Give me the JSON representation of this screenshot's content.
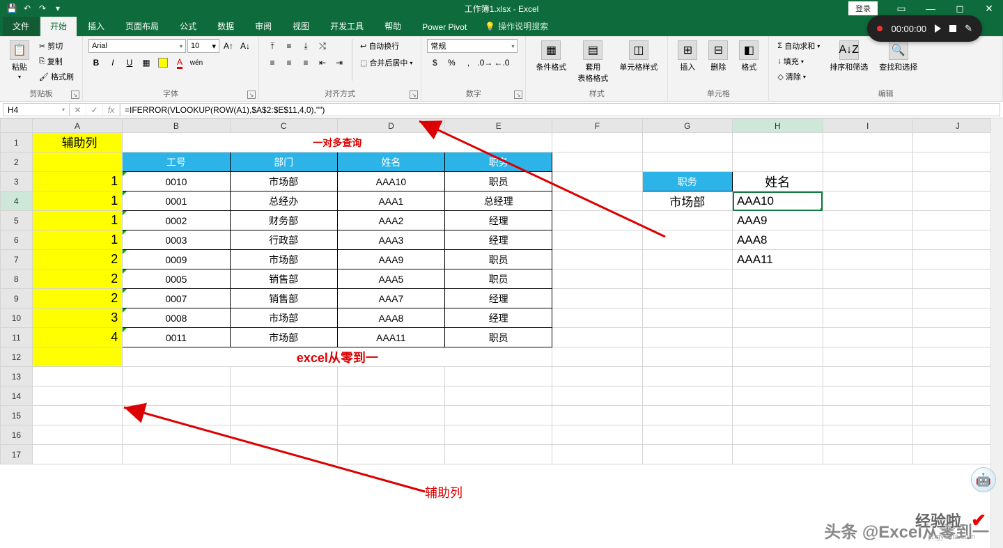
{
  "titlebar": {
    "title": "工作簿1.xlsx - Excel",
    "login": "登录"
  },
  "recorder": {
    "time": "00:00:00"
  },
  "tabs": {
    "file": "文件",
    "home": "开始",
    "insert": "插入",
    "page_layout": "页面布局",
    "formulas": "公式",
    "data": "数据",
    "review": "审阅",
    "view": "视图",
    "dev": "开发工具",
    "help": "帮助",
    "powerpivot": "Power Pivot",
    "tell_me": "操作说明搜索"
  },
  "ribbon": {
    "clipboard": {
      "paste": "粘贴",
      "cut": "剪切",
      "copy": "复制",
      "painter": "格式刷",
      "label": "剪贴板"
    },
    "font": {
      "name": "Arial",
      "size": "10",
      "label": "字体"
    },
    "align": {
      "wrap": "自动换行",
      "merge": "合并后居中",
      "label": "对齐方式"
    },
    "number": {
      "format": "常规",
      "label": "数字"
    },
    "styles": {
      "cond": "条件格式",
      "tbl": "套用\n表格格式",
      "cell": "单元格样式",
      "label": "样式"
    },
    "cells": {
      "insert": "插入",
      "delete": "删除",
      "format": "格式",
      "label": "单元格"
    },
    "editing": {
      "sum": "自动求和",
      "fill": "填充",
      "clear": "清除",
      "sort": "排序和筛选",
      "find": "查找和选择",
      "label": "编辑"
    }
  },
  "namebox": "H4",
  "formula": "=IFERROR(VLOOKUP(ROW(A1),$A$2:$E$11,4,0),\"\")",
  "columns": [
    "A",
    "B",
    "C",
    "D",
    "E",
    "F",
    "G",
    "H",
    "I",
    "J"
  ],
  "rows": [
    "1",
    "2",
    "3",
    "4",
    "5",
    "6",
    "7",
    "8",
    "9",
    "10",
    "11",
    "12",
    "13",
    "14",
    "15",
    "16",
    "17"
  ],
  "sheet": {
    "a1": "辅助列",
    "title": "一对多查询",
    "headers": {
      "b": "工号",
      "c": "部门",
      "d": "姓名",
      "e": "职务"
    },
    "data": [
      {
        "a": "1",
        "b": "0010",
        "c": "市场部",
        "d": "AAA10",
        "e": "职员"
      },
      {
        "a": "1",
        "b": "0001",
        "c": "总经办",
        "d": "AAA1",
        "e": "总经理"
      },
      {
        "a": "1",
        "b": "0002",
        "c": "财务部",
        "d": "AAA2",
        "e": "经理"
      },
      {
        "a": "1",
        "b": "0003",
        "c": "行政部",
        "d": "AAA3",
        "e": "经理"
      },
      {
        "a": "2",
        "b": "0009",
        "c": "市场部",
        "d": "AAA9",
        "e": "职员"
      },
      {
        "a": "2",
        "b": "0005",
        "c": "销售部",
        "d": "AAA5",
        "e": "职员"
      },
      {
        "a": "2",
        "b": "0007",
        "c": "销售部",
        "d": "AAA7",
        "e": "经理"
      },
      {
        "a": "3",
        "b": "0008",
        "c": "市场部",
        "d": "AAA8",
        "e": "经理"
      },
      {
        "a": "4",
        "b": "0011",
        "c": "市场部",
        "d": "AAA11",
        "e": "职员"
      }
    ],
    "lookup_hdr": {
      "g": "职务",
      "h": "姓名"
    },
    "lookup": {
      "g4": "市场部",
      "h4": "AAA10",
      "h5": "AAA9",
      "h6": "AAA8",
      "h7": "AAA11"
    },
    "subtitle": "excel从零到一",
    "annot_aux": "辅助列"
  },
  "brand": "头条 @Excel从零到一",
  "brand2": "经验啦",
  "brand2_sub": "jingyanla.com"
}
